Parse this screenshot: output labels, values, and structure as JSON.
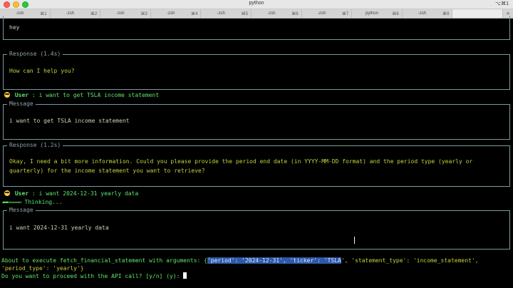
{
  "window": {
    "title": "python",
    "shortcut": "⌥⌘1"
  },
  "tabs": [
    {
      "label": "-zsh",
      "shortcut": "⌘1",
      "active": false
    },
    {
      "label": "-zsh",
      "shortcut": "⌘2",
      "active": false
    },
    {
      "label": "-zsh",
      "shortcut": "⌘3",
      "active": false
    },
    {
      "label": "-zsh",
      "shortcut": "⌘4",
      "active": false
    },
    {
      "label": "-zsh",
      "shortcut": "⌘5",
      "active": false
    },
    {
      "label": "-zsh",
      "shortcut": "⌘6",
      "active": false
    },
    {
      "label": "-zsh",
      "shortcut": "⌘7",
      "active": false
    },
    {
      "label": "python",
      "shortcut": "⌘8",
      "active": false
    },
    {
      "label": "-zsh",
      "shortcut": "⌘9",
      "active": false
    },
    {
      "label": "",
      "shortcut": "",
      "active": true
    }
  ],
  "conversation": {
    "first_message": "hey",
    "response1": {
      "title": "Response (1.4s)",
      "text": "How can I help you?"
    },
    "user1": {
      "label": "User",
      "sep": ":",
      "text": "i want to get TSLA income statement"
    },
    "message2": {
      "title": "Message",
      "text": "i want to get TSLA income statement"
    },
    "response2": {
      "title": "Response (1.2s)",
      "line1": "Okay, I need a bit more information.  Could you please provide the period end date (in YYYY-MM-DD format) and the period type (yearly or",
      "line2": "quarterly) for the income statement you want to retrieve?"
    },
    "user2": {
      "label": "User",
      "sep": ":",
      "text": "i want 2024-12-31 yearly data"
    },
    "thinking": {
      "spinner": "▰▰▱▱▱▱▱",
      "text": "Thinking..."
    },
    "message3": {
      "title": "Message",
      "text": "i want 2024-12-31 yearly data"
    },
    "exec": {
      "prefix": "About to execute fetch_financial_statement with arguments: {",
      "selected": "'period': '2024-12-31', 'ticker': 'TSLA",
      "rest": "', 'statement_type': 'income_statement',",
      "line2": "'period_type': 'yearly'}"
    },
    "confirm": {
      "prompt": "Do you want to proceed with the API call? [y/n] (y): "
    }
  }
}
